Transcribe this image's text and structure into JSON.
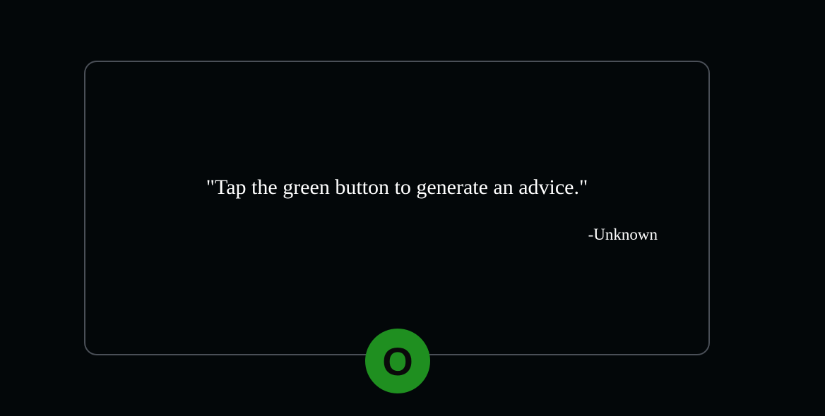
{
  "advice_card": {
    "quote": "\"Tap the green button to generate an advice.\"",
    "author": "-Unknown"
  },
  "generate_button": {
    "label": "O",
    "color": "#1f8f20"
  },
  "colors": {
    "background": "#030709",
    "card_border": "#4a4f57",
    "text": "#ffffff"
  }
}
